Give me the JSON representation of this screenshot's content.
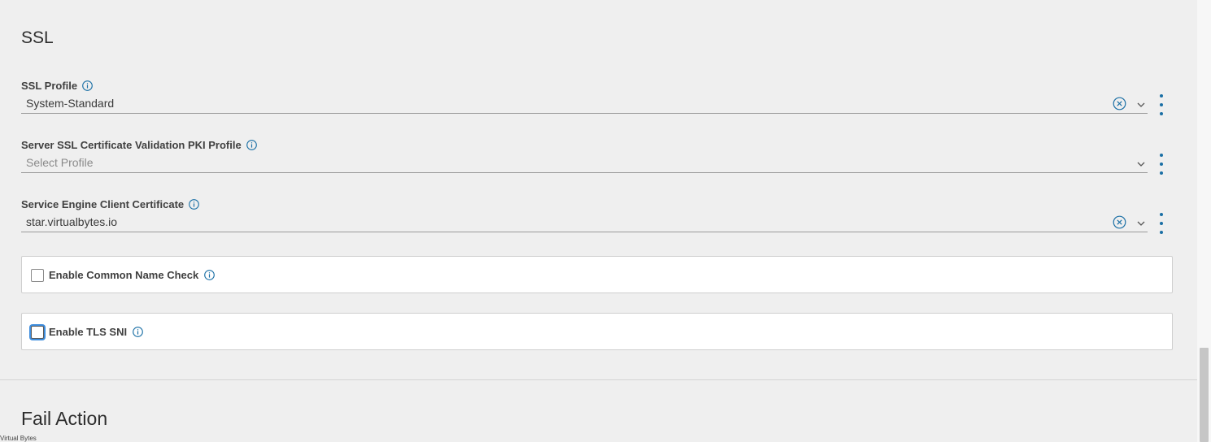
{
  "ssl": {
    "title": "SSL",
    "ssl_profile": {
      "label": "SSL Profile",
      "value": "System-Standard"
    },
    "pki_profile": {
      "label": "Server SSL Certificate Validation PKI Profile",
      "placeholder": "Select Profile"
    },
    "client_cert": {
      "label": "Service Engine Client Certificate",
      "value": "star.virtualbytes.io"
    },
    "common_name_check": {
      "label": "Enable Common Name Check",
      "checked": false
    },
    "tls_sni": {
      "label": "Enable TLS SNI",
      "checked": false
    }
  },
  "fail_action": {
    "title": "Fail Action"
  },
  "footer": {
    "brand": "Virtual Bytes"
  },
  "colors": {
    "accent": "#1a6fa5",
    "background": "#efefef",
    "panel": "#ffffff"
  }
}
